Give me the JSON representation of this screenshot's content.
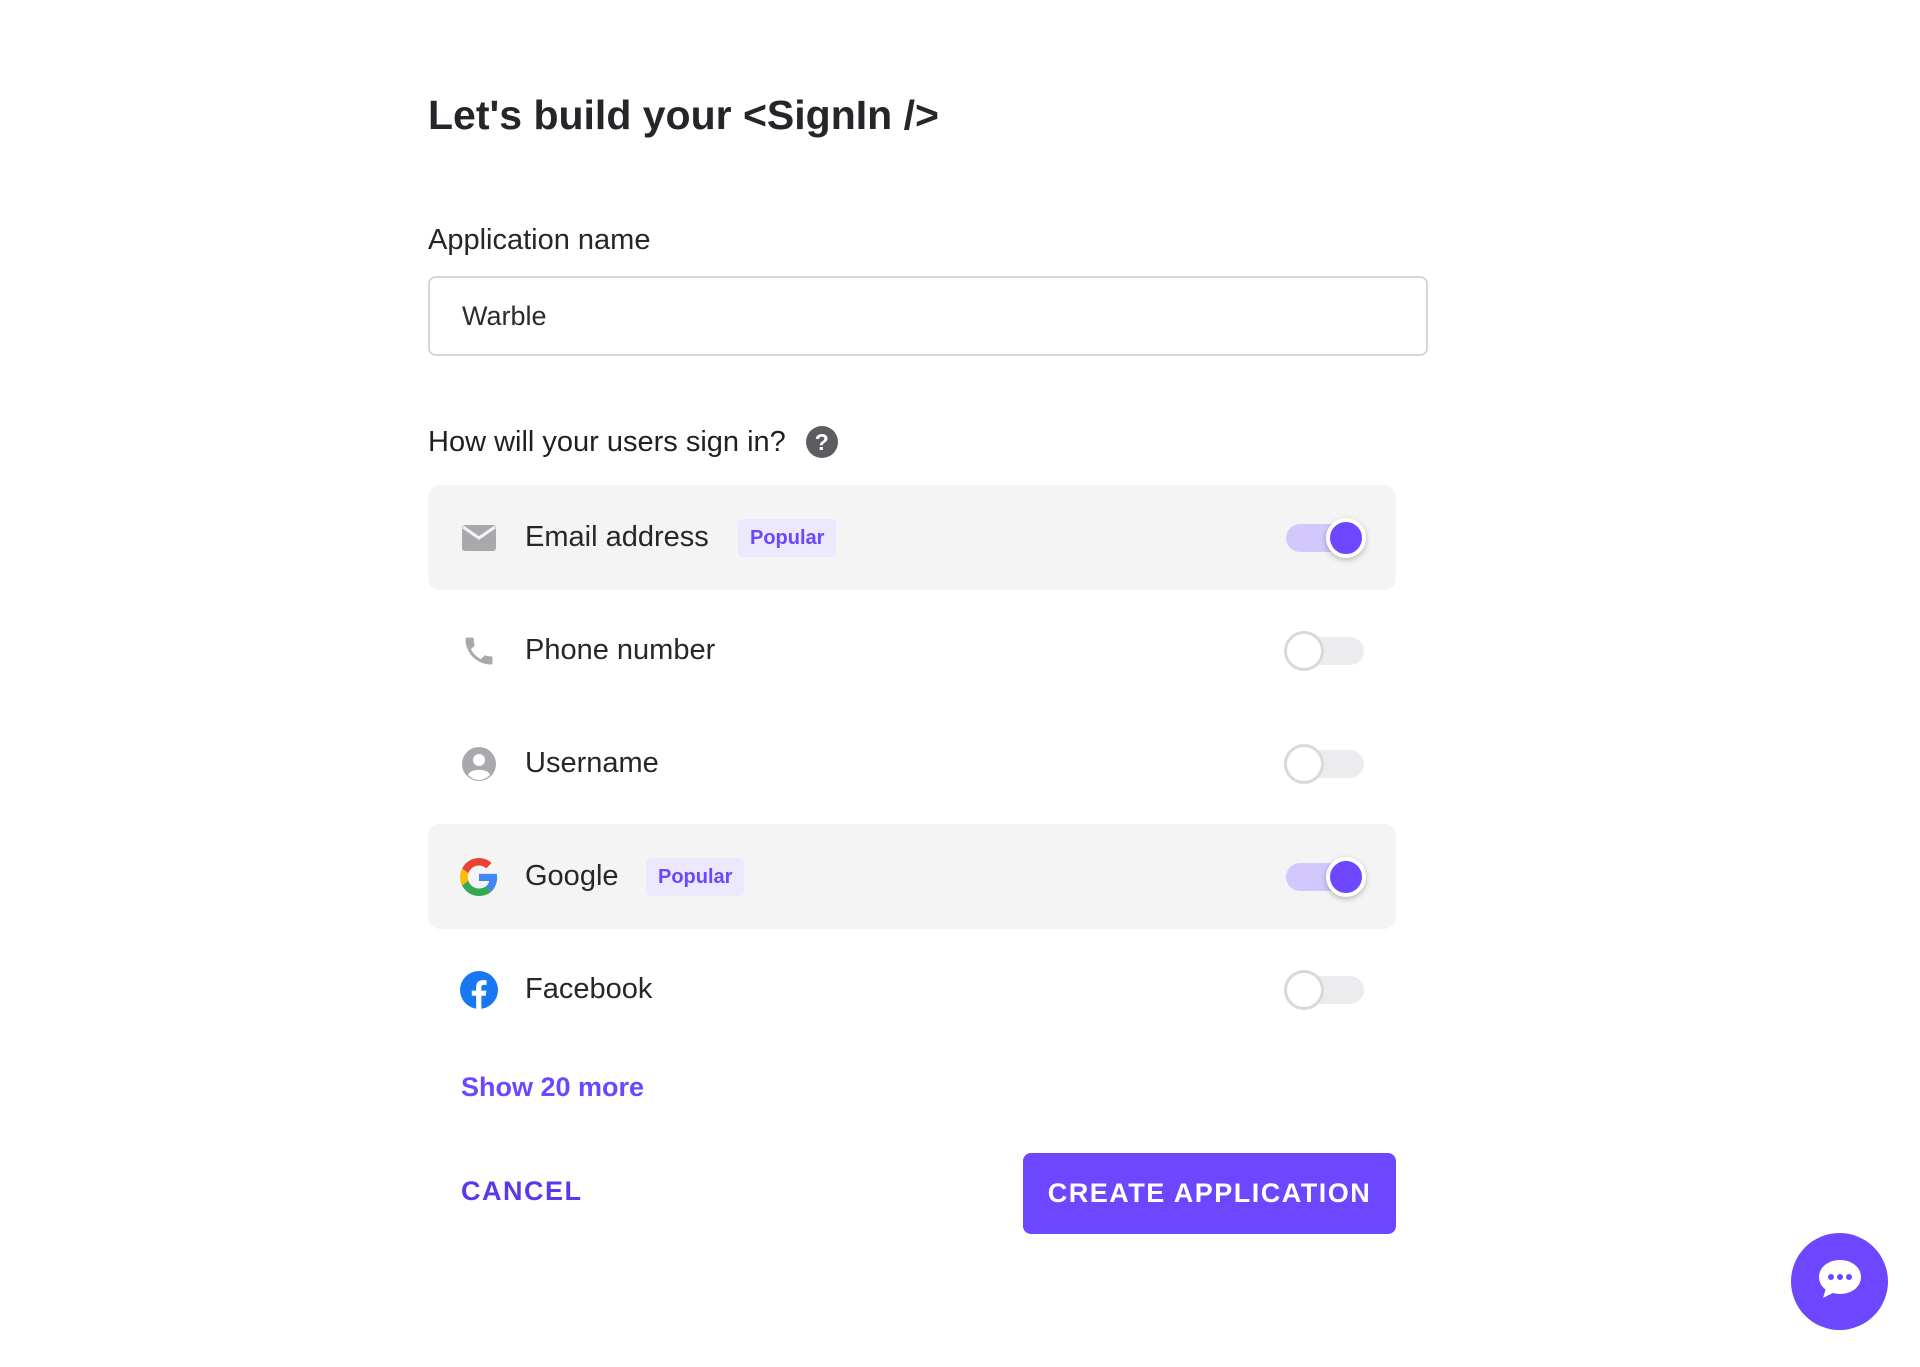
{
  "title": "Let's build your <SignIn />",
  "app_name": {
    "label": "Application name",
    "value": "Warble"
  },
  "sign_in_section": {
    "label": "How will your users sign in?",
    "help_glyph": "?"
  },
  "methods": [
    {
      "label": "Email address",
      "icon": "mail-icon",
      "badge": "Popular",
      "enabled": true
    },
    {
      "label": "Phone number",
      "icon": "phone-icon",
      "badge": "",
      "enabled": false
    },
    {
      "label": "Username",
      "icon": "user-icon",
      "badge": "",
      "enabled": false
    },
    {
      "label": "Google",
      "icon": "google-icon",
      "badge": "Popular",
      "enabled": true
    },
    {
      "label": "Facebook",
      "icon": "facebook-icon",
      "badge": "",
      "enabled": false
    }
  ],
  "show_more": "Show 20 more",
  "actions": {
    "cancel": "CANCEL",
    "create": "CREATE APPLICATION"
  },
  "colors": {
    "accent": "#6c47ff",
    "toggle_on_track": "#d2c8fd",
    "active_row_bg": "#f4f4f5",
    "badge_bg": "#ece8fd"
  }
}
